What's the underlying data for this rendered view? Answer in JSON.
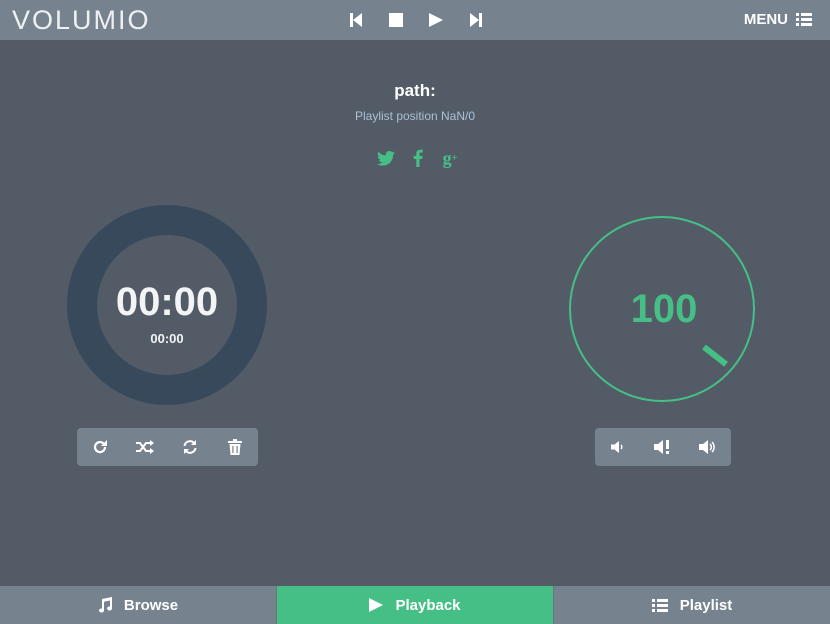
{
  "app": {
    "logo_text": "VOLUMIO",
    "brand_color": "#46bf86"
  },
  "header": {
    "transport": [
      {
        "name": "previous",
        "icon": "skip-previous-icon"
      },
      {
        "name": "stop",
        "icon": "stop-icon"
      },
      {
        "name": "play",
        "icon": "play-icon"
      },
      {
        "name": "next",
        "icon": "skip-next-icon"
      }
    ],
    "menu_label": "MENU"
  },
  "track": {
    "title": "path:",
    "playlist_position": "Playlist position NaN/0"
  },
  "social": [
    "twitter-icon",
    "facebook-icon",
    "google-plus-icon"
  ],
  "time": {
    "elapsed": "00:00",
    "total": "00:00"
  },
  "playback_controls": [
    "repeat-icon",
    "shuffle-icon",
    "consume-icon",
    "clear-icon"
  ],
  "volume": {
    "value": "100",
    "controls": [
      "volume-down-icon",
      "mute-icon",
      "volume-up-icon"
    ]
  },
  "tabs": [
    {
      "label": "Browse",
      "icon": "music-note-icon",
      "active": false
    },
    {
      "label": "Playback",
      "icon": "play-icon",
      "active": true
    },
    {
      "label": "Playlist",
      "icon": "list-icon",
      "active": false
    }
  ]
}
